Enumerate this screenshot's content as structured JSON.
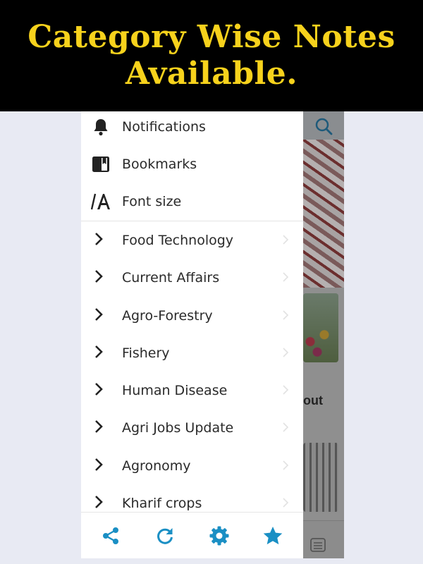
{
  "banner": {
    "line1": "Category Wise Notes",
    "line2": "Available."
  },
  "drawer": {
    "top_items": [
      {
        "label": "Notifications",
        "icon": "bell-icon"
      },
      {
        "label": "Bookmarks",
        "icon": "bookmark-icon"
      },
      {
        "label": "Font size",
        "icon": "font-size-icon"
      }
    ],
    "categories": [
      {
        "label": "Food Technology"
      },
      {
        "label": "Current Affairs"
      },
      {
        "label": "Agro-Forestry"
      },
      {
        "label": "Fishery"
      },
      {
        "label": "Human Disease"
      },
      {
        "label": "Agri Jobs Update"
      },
      {
        "label": "Agronomy"
      },
      {
        "label": "Kharif crops"
      }
    ],
    "bottom_actions": [
      "share-icon",
      "refresh-icon",
      "settings-icon",
      "star-icon"
    ]
  },
  "background_app": {
    "partial_text": "out"
  },
  "colors": {
    "banner_bg": "#000000",
    "banner_text": "#f7d21c",
    "accent": "#1a8fc4"
  }
}
